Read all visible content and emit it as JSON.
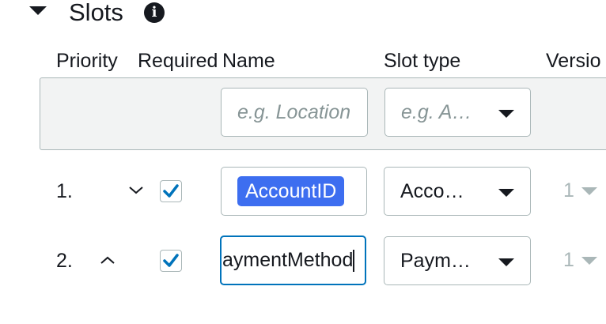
{
  "section": {
    "title": "Slots",
    "info_icon": "info-icon"
  },
  "columns": {
    "priority": "Priority",
    "required": "Required",
    "name": "Name",
    "slot_type": "Slot type",
    "version": "Versio"
  },
  "new_slot": {
    "name_placeholder": "e.g. Location",
    "slot_type_placeholder": "e.g. A…"
  },
  "slots": [
    {
      "priority": "1.",
      "move_icon": "chevron-down-icon",
      "required": true,
      "name": "AccountID",
      "slot_type": "Acco…",
      "version": "1"
    },
    {
      "priority": "2.",
      "move_icon": "chevron-up-icon",
      "required": true,
      "name": "aymentMethod",
      "slot_type": "Paym…",
      "version": "1"
    }
  ],
  "colors": {
    "accent": "#0073bb",
    "selection": "#3d6ef0",
    "panel_bg": "#f2f3f3"
  }
}
